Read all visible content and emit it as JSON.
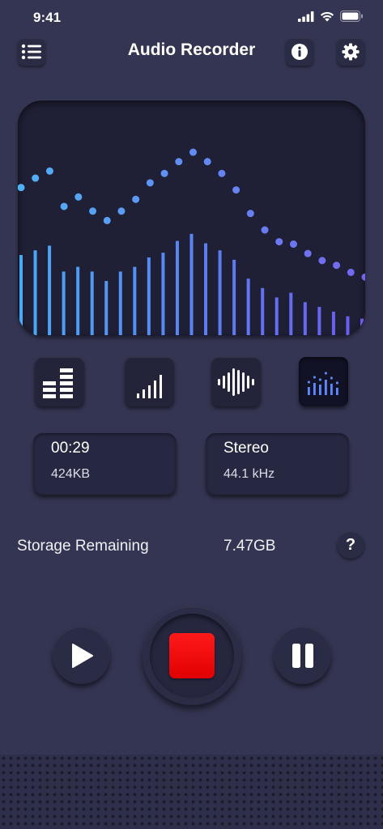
{
  "status_bar": {
    "time": "9:41"
  },
  "header": {
    "title": "Audio Recorder",
    "menu_icon": "list-icon",
    "info_icon": "info-icon",
    "settings_icon": "gear-icon"
  },
  "visualizer": {
    "bar_heights": [
      0.34,
      0.36,
      0.38,
      0.27,
      0.29,
      0.27,
      0.23,
      0.27,
      0.29,
      0.33,
      0.35,
      0.4,
      0.43,
      0.39,
      0.36,
      0.32,
      0.24,
      0.2,
      0.16,
      0.18,
      0.14,
      0.12,
      0.1,
      0.08,
      0.07
    ],
    "dot_levels": [
      0.63,
      0.67,
      0.7,
      0.55,
      0.59,
      0.53,
      0.49,
      0.53,
      0.58,
      0.65,
      0.69,
      0.74,
      0.78,
      0.74,
      0.69,
      0.62,
      0.52,
      0.45,
      0.4,
      0.39,
      0.35,
      0.32,
      0.3,
      0.27,
      0.25
    ],
    "colors": {
      "bar_start": "#4aa9f5",
      "bar_end": "#6c5cf0",
      "dot_start": "#4fb1f7",
      "dot_end": "#7566ee"
    }
  },
  "modes": [
    {
      "name": "bars-mode",
      "icon": "equalizer-bars-icon",
      "active": false
    },
    {
      "name": "signal-mode",
      "icon": "signal-strength-icon",
      "active": false
    },
    {
      "name": "waveform-mode",
      "icon": "waveform-icon",
      "active": false
    },
    {
      "name": "spectrum-mode",
      "icon": "spectrum-dots-icon",
      "active": true
    }
  ],
  "recording_info": {
    "duration": "00:29",
    "size": "424KB"
  },
  "audio_info": {
    "channel": "Stereo",
    "sample_rate": "44.1 kHz"
  },
  "storage": {
    "label": "Storage Remaining",
    "value": "7.47GB",
    "help_label": "?"
  },
  "controls": {
    "play_icon": "play-icon",
    "stop_icon": "stop-icon",
    "pause_icon": "pause-icon",
    "stop_color": "#ff0f0f"
  }
}
